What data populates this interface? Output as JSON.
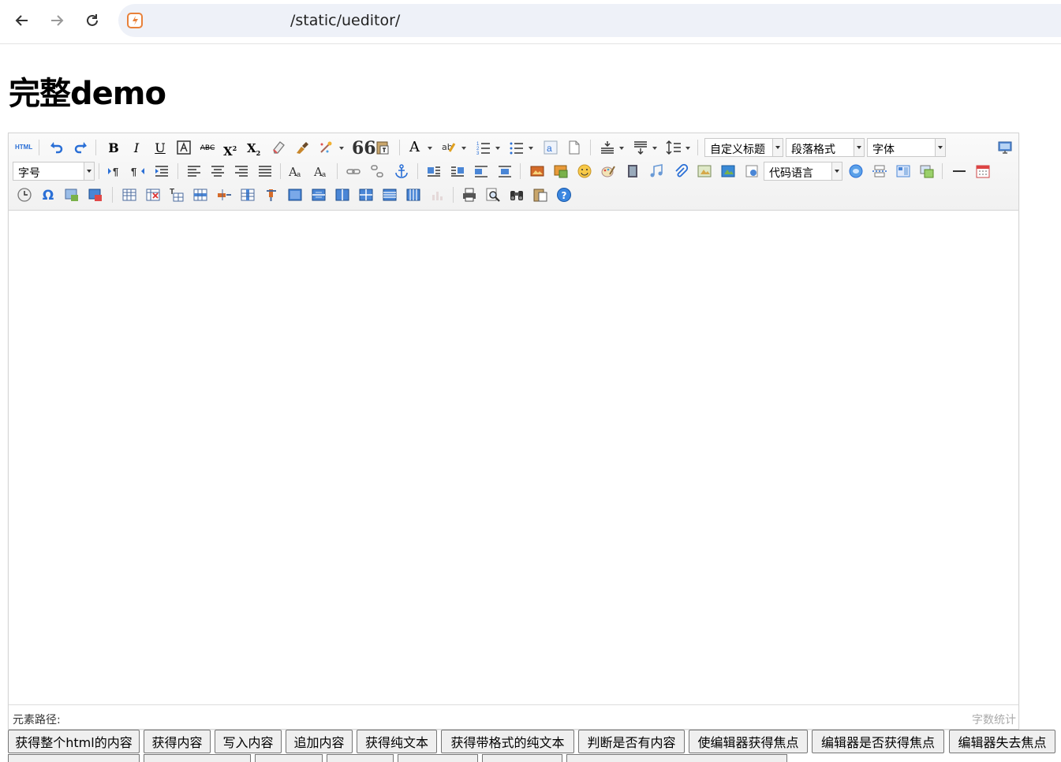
{
  "browser": {
    "url": "/static/ueditor/",
    "icons": [
      "back-arrow-icon",
      "forward-arrow-icon",
      "reload-icon",
      "site-icon"
    ]
  },
  "page": {
    "title": "完整demo"
  },
  "editor": {
    "toolbar": {
      "source_label": "HTML",
      "text_a": "A",
      "combos": {
        "custom_heading": "自定义标题",
        "paragraph_format": "段落格式",
        "font_family": "字体",
        "font_size": "字号",
        "code_language": "代码语言"
      }
    },
    "status": {
      "path_label": "元素路径:",
      "word_count_label": "字数统计"
    }
  },
  "buttons": [
    "获得整个html的内容",
    "获得内容",
    "写入内容",
    "追加内容",
    "获得纯文本",
    "获得带格式的纯文本",
    "判断是否有内容",
    "使编辑器获得焦点",
    "编辑器是否获得焦点",
    "编辑器失去焦点"
  ],
  "colors": {
    "accent_blue": "#2a6fd6",
    "toolbar_bg": "#f4f4f4",
    "border": "#d4d4d4"
  }
}
